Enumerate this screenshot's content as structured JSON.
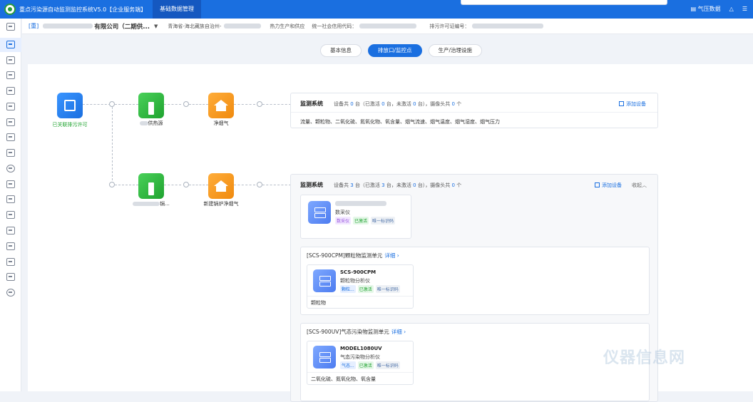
{
  "header": {
    "app_title": "重点污染源自动监测监控系统V5.0【企业服务端】",
    "active_tab": "基础数据管理",
    "right_link": "气压数据"
  },
  "company_bar": {
    "tag": "[重]",
    "company_name": "有限公司（二期供...",
    "region": "青海省-海北藏族自治州-",
    "industry": "热力生产和供应",
    "credit_code_label": "统一社会信用代码：",
    "permit_label": "排污许可证编号："
  },
  "tabs": [
    "基本信息",
    "排放口/监控点",
    "生产/治理设施"
  ],
  "active_tab_index": 1,
  "flow": {
    "root_label": "已关联排污许可",
    "row1": {
      "source_label": "供热源",
      "outlet_label": "净烟气"
    },
    "row2": {
      "source_label": "锅...",
      "outlet_label": "新建锅炉净烟气"
    }
  },
  "monitor1": {
    "title": "监测系统",
    "stats": [
      "设备共",
      "0",
      "台（已激活",
      "0",
      "台，未激活",
      "0",
      "台），摄像头共",
      "0",
      "个"
    ],
    "add_label": "添加设备",
    "params": "流量、颗粒物、二氧化硫、氮氧化物、氧含量、烟气流速、烟气温度、烟气湿度、烟气压力"
  },
  "monitor2": {
    "title": "监测系统",
    "stats": [
      "设备共",
      "3",
      "台（已激活",
      "3",
      "台，未激活",
      "0",
      "台），摄像头共",
      "0",
      "个"
    ],
    "add_label": "添加设备",
    "collapse_label": "收起",
    "collector": {
      "type": "数采仪",
      "badges": [
        "数采仪",
        "已激活",
        "唯一标识码"
      ]
    },
    "units": [
      {
        "title": "[SCS-900CPM]颗粒物监测单元",
        "detail": "详细",
        "model": "SCS-900CPM",
        "type": "颗粒物分析仪",
        "badges": [
          "颗粒...",
          "已激活",
          "唯一标识码"
        ],
        "params": "颗粒物"
      },
      {
        "title": "[SCS-900UV]气态污染物监测单元",
        "detail": "详细",
        "model": "MODEL1080UV",
        "type": "气态污染物分析仪",
        "badges": [
          "气态...",
          "已激活",
          "唯一标识码"
        ],
        "params": "二氧化硫、氮氧化物、氧含量"
      }
    ]
  },
  "watermark": "仪器信息网",
  "colors": {
    "primary": "#1a6fe0",
    "green": "#1fa32f",
    "orange": "#f08a0e"
  }
}
